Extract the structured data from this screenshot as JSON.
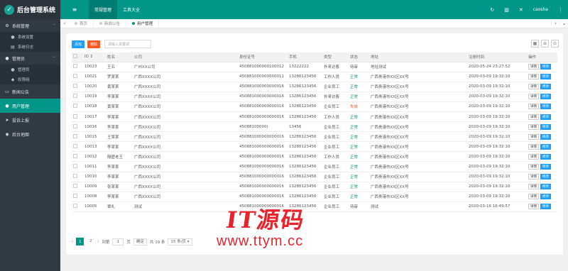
{
  "brand": {
    "title": "后台管理系统",
    "logo_icon": "leaf-icon"
  },
  "sidebar": {
    "groups": [
      {
        "label": "系统管理",
        "icon": "gear-icon",
        "expanded": true,
        "children": [
          {
            "label": "系统设置",
            "icon": "user-icon"
          },
          {
            "label": "系统日志",
            "icon": "list-icon"
          }
        ]
      },
      {
        "label": "管理员",
        "icon": "user-icon",
        "expanded": true,
        "children": [
          {
            "label": "管理员",
            "icon": "user-icon"
          },
          {
            "label": "权限组",
            "icon": "users-icon"
          }
        ]
      }
    ],
    "items": [
      {
        "label": "新闻公告",
        "icon": "doc-icon",
        "active": false
      },
      {
        "label": "用户管理",
        "icon": "user-icon",
        "active": true
      },
      {
        "label": "投诉上报",
        "icon": "send-icon",
        "active": false
      },
      {
        "label": "后台地图",
        "icon": "map-icon",
        "active": false
      }
    ]
  },
  "topbar": {
    "menu_icon": "menu-toggle-icon",
    "tabs": [
      {
        "label": "常规管理",
        "active": true
      },
      {
        "label": "工具大全",
        "active": false
      }
    ],
    "username": "caosha",
    "accent": "#009688"
  },
  "tabbar": {
    "tabs": [
      {
        "label": "首页",
        "active": false
      },
      {
        "label": "新闻公告",
        "active": false
      },
      {
        "label": "用户管理",
        "active": true
      }
    ]
  },
  "toolbar": {
    "add_label": "添加",
    "delete_label": "删除",
    "search_placeholder": "请输入关键词"
  },
  "table": {
    "columns": [
      "",
      "ID ↕",
      "姓名",
      "公司",
      "身份证号",
      "手机",
      "类型",
      "状态",
      "地址",
      "注册时间",
      "操作"
    ],
    "action_labels": {
      "view": "详情",
      "edit": "修改"
    },
    "rows": [
      {
        "id": "10023",
        "name": "王五",
        "company": "广州XX公司",
        "idcard": "450881000000100012",
        "phone": "13222222",
        "type": "外来访客",
        "status": "待审",
        "status_kind": "wait",
        "address": "地址测试",
        "time": "2020-05-24 23:27:52"
      },
      {
        "id": "10021",
        "name": "罗某某",
        "company": "广西XXXX公司",
        "idcard": "450881000000000011",
        "phone": "13286123456",
        "type": "工作人员",
        "status": "正常",
        "status_kind": "ok",
        "address": "广西贵港市XX区XX号",
        "time": "2020-03-09 19:32:10"
      },
      {
        "id": "10020",
        "name": "黄某某",
        "company": "广西XXXX公司",
        "idcard": "450881000000000016",
        "phone": "13286123456",
        "type": "企业员工",
        "status": "正常",
        "status_kind": "ok",
        "address": "广西贵港市XX区XX号",
        "time": "2020-03-09 19:32:10"
      },
      {
        "id": "10019",
        "name": "李某某",
        "company": "广西XXXX公司",
        "idcard": "450881000000000016",
        "phone": "13286123456",
        "type": "外来访客",
        "status": "正常",
        "status_kind": "ok",
        "address": "广西贵港市XX区XX号",
        "time": "2020-03-09 19:32:10"
      },
      {
        "id": "10018",
        "name": "黄某某",
        "company": "广西XXXX公司",
        "idcard": "450881000000000016",
        "phone": "13286123456",
        "type": "企业员工",
        "status": "失效",
        "status_kind": "fail",
        "address": "广西贵港市XX区XX号",
        "time": "2020-03-09 19:32:10"
      },
      {
        "id": "10017",
        "name": "李某某",
        "company": "广西XXXX公司",
        "idcard": "450881000000000016",
        "phone": "13286123456",
        "type": "工作人员",
        "status": "正常",
        "status_kind": "ok",
        "address": "广西贵港市XX区XX号",
        "time": "2020-03-09 19:32:10"
      },
      {
        "id": "10016",
        "name": "李某某",
        "company": "广西XXXX公司",
        "idcard": "45088100000(",
        "phone": "13456",
        "type": "企业员工",
        "status": "正常",
        "status_kind": "ok",
        "address": "广西贵港市XX区XX号",
        "time": "2020-03-09 19:32:10"
      },
      {
        "id": "10015",
        "name": "王某某",
        "company": "广西XXXX公司",
        "idcard": "450881000000000016",
        "phone": "13286123456",
        "type": "企业员工",
        "status": "正常",
        "status_kind": "ok",
        "address": "广西贵港市XX区XX号",
        "time": "2020-03-09 19:32:10"
      },
      {
        "id": "10013",
        "name": "李某某",
        "company": "广西XXXX公司",
        "idcard": "450881000000000016",
        "phone": "13286123456",
        "type": "企业员工",
        "status": "正常",
        "status_kind": "ok",
        "address": "广西贵港市XX区XX号",
        "time": "2020-03-09 19:32:10"
      },
      {
        "id": "10012",
        "name": "隔壁老王",
        "company": "广西XXXX公司",
        "idcard": "450881000000000016",
        "phone": "13286123456",
        "type": "工作人员",
        "status": "正常",
        "status_kind": "ok",
        "address": "广西贵港市XX区XX号",
        "time": "2020-03-09 19:32:10"
      },
      {
        "id": "10011",
        "name": "李某某",
        "company": "广西XXXX公司",
        "idcard": "450881000000000016",
        "phone": "13286123456",
        "type": "企业员工",
        "status": "正常",
        "status_kind": "ok",
        "address": "广西贵港市XX区XX号",
        "time": "2020-03-09 19:32:10"
      },
      {
        "id": "10010",
        "name": "李某某",
        "company": "广西XXXX公司",
        "idcard": "450881000000000016",
        "phone": "13286123456",
        "type": "企业员工",
        "status": "正常",
        "status_kind": "ok",
        "address": "广西贵港市XX区XX号",
        "time": "2020-03-09 19:32:10"
      },
      {
        "id": "10009",
        "name": "张某某",
        "company": "广西XXXX公司",
        "idcard": "450881000000000016",
        "phone": "13286123456",
        "type": "企业员工",
        "status": "正常",
        "status_kind": "ok",
        "address": "广西贵港市XX区XX号",
        "time": "2020-03-09 19:32:10"
      },
      {
        "id": "10008",
        "name": "李某某",
        "company": "广西XXXX公司",
        "idcard": "450881000000000016",
        "phone": "13286123456",
        "type": "企业员工",
        "status": "正常",
        "status_kind": "ok",
        "address": "广西贵港市XX区XX号",
        "time": "2020-03-09 19:32:10"
      },
      {
        "id": "10005",
        "name": "覃礼",
        "company": "测试",
        "idcard": "450881000000000016",
        "phone": "13286123456",
        "type": "企业员工",
        "status": "待审",
        "status_kind": "wait",
        "address": "测试",
        "time": "2020-03-16 16:49:57"
      }
    ]
  },
  "pager": {
    "pages": [
      "1",
      "2"
    ],
    "current": "1",
    "goto_prefix": "到第",
    "goto_value": "1",
    "goto_suffix": "页",
    "confirm": "确定",
    "total": "共 19 条",
    "per_page": "15 条/页"
  },
  "watermark": {
    "big": "IT源码",
    "small": "www.ttym.cc"
  },
  "colors": {
    "accent": "#009688",
    "add": "#1e9fff",
    "delete": "#ff5722",
    "sidebar": "#2f3a45"
  }
}
